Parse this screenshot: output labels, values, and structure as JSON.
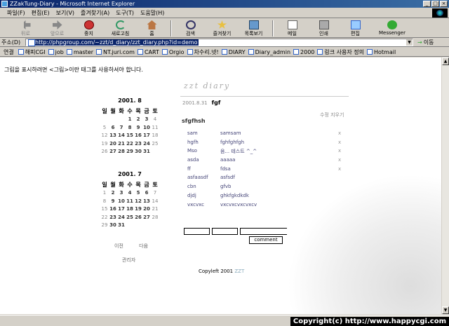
{
  "window": {
    "title": "ZZakTung-Diary - Microsoft Internet Explorer"
  },
  "menu": [
    "파일(F)",
    "편집(E)",
    "보기(V)",
    "즐겨찾기(A)",
    "도구(T)",
    "도움말(H)"
  ],
  "toolbar": {
    "back": "뒤로",
    "forward": "앞으로",
    "stop": "중지",
    "refresh": "새로고침",
    "home": "홈",
    "search": "검색",
    "favorites": "즐겨찾기",
    "history": "목록보기",
    "mail": "메일",
    "print": "인쇄",
    "edit": "편집",
    "messenger": "Messenger"
  },
  "address": {
    "label": "주소(D)",
    "url": "http://phpgroup.com/~zzt/d_diary/zzt_diary.php?id=demo",
    "go": "이동"
  },
  "links": {
    "label": "연결",
    "items": [
      "해피CGI",
      "job",
      "master",
      "NT.juri.com",
      "CART",
      "Orgio",
      "차수리.넷!",
      "DIARY",
      "Diary_admin",
      "2000",
      "링크 사용자 정의",
      "Hotmail"
    ]
  },
  "page": {
    "notice": "그림을 표시하려면 <그림>이란 태그를 사용하셔야 합니다.",
    "logo": "zzt diary",
    "cal1": {
      "title": "2001. 8",
      "days": [
        "일",
        "월",
        "화",
        "수",
        "목",
        "금",
        "토"
      ],
      "weeks": [
        [
          "",
          "",
          "",
          "1",
          "2",
          "3",
          "4"
        ],
        [
          "5",
          "6",
          "7",
          "8",
          "9",
          "10",
          "11"
        ],
        [
          "12",
          "13",
          "14",
          "15",
          "16",
          "17",
          "18"
        ],
        [
          "19",
          "20",
          "21",
          "22",
          "23",
          "24",
          "25"
        ],
        [
          "26",
          "27",
          "28",
          "29",
          "30",
          "31",
          ""
        ]
      ]
    },
    "cal2": {
      "title": "2001. 7",
      "days": [
        "일",
        "월",
        "화",
        "수",
        "목",
        "금",
        "토"
      ],
      "weeks": [
        [
          "1",
          "2",
          "3",
          "4",
          "5",
          "6",
          "7"
        ],
        [
          "8",
          "9",
          "10",
          "11",
          "12",
          "13",
          "14"
        ],
        [
          "15",
          "16",
          "17",
          "18",
          "19",
          "20",
          "21"
        ],
        [
          "22",
          "23",
          "24",
          "25",
          "26",
          "27",
          "28"
        ],
        [
          "29",
          "30",
          "31",
          "",
          "",
          "",
          ""
        ]
      ]
    },
    "prev": "이전",
    "next": "다음",
    "admin": "관리자",
    "entry": {
      "date": "2001.8.31",
      "title": "fgf",
      "edit_links": "수정 지우기",
      "body": "sfgfhsh"
    },
    "comments": [
      {
        "name": "sam",
        "text": "samsam"
      },
      {
        "name": "hgfh",
        "text": "fghfghfgh"
      },
      {
        "name": "Mso",
        "text": "음... 테스트 ^_^"
      },
      {
        "name": "asda",
        "text": "aaaaa"
      },
      {
        "name": "ff",
        "text": "fdsa"
      },
      {
        "name": "asfaasdf",
        "text": "asfsdf"
      },
      {
        "name": "cbn",
        "text": "gfvb"
      },
      {
        "name": "djdj",
        "text": "ghkfgkdkdk"
      },
      {
        "name": "vxcvxc",
        "text": "vxcvxcvxcvxcv"
      }
    ],
    "delete_mark": "x",
    "comment_button": "comment",
    "copyleft": "Copyleft 2001",
    "copyleft_brand": "ZZT"
  },
  "watermark": "Copyright(c) http://www.happycgi.com"
}
